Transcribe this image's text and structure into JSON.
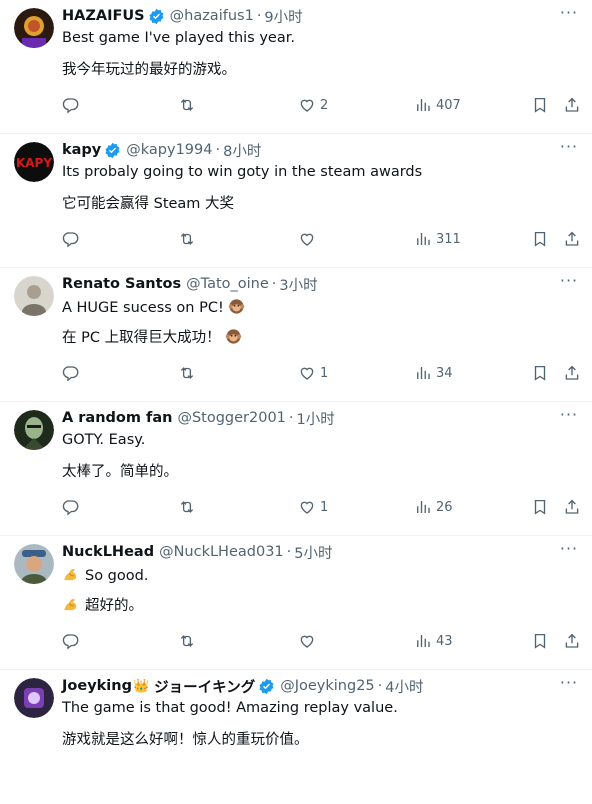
{
  "replies": [
    {
      "name": "HAZAIFUS",
      "handle": "@hazaifus1",
      "time": "9小时",
      "text": "Best game I've played this year.",
      "translation": "我今年玩过的最好的游戏。",
      "replies": "",
      "retweets": "",
      "likes": "2",
      "views": "407",
      "avatar_color": "#3a2a1a"
    },
    {
      "name": "kapy",
      "handle": "@kapy1994",
      "time": "8小时",
      "text": "Its probaly going to win goty in the steam awards",
      "translation": "它可能会赢得 Steam 大奖",
      "replies": "",
      "retweets": "",
      "likes": "",
      "views": "311",
      "avatar_color": "#0d0d0d"
    },
    {
      "name": "Renato Santos",
      "handle": "@Tato_oine",
      "time": "3小时",
      "text": "A HUGE sucess on PC!",
      "translation": "在 PC 上取得巨大成功！",
      "replies": "",
      "retweets": "",
      "likes": "1",
      "views": "34",
      "avatar_color": "#c9c6bd"
    },
    {
      "name": "A random fan",
      "handle": "@Stogger2001",
      "time": "1小时",
      "text": "GOTY. Easy.",
      "translation": "太棒了。简单的。",
      "replies": "",
      "retweets": "",
      "likes": "1",
      "views": "26",
      "avatar_color": "#1f2a1c"
    },
    {
      "name": "NuckLHead",
      "handle": "@NuckLHead031",
      "time": "5小时",
      "text": "So good.",
      "translation": "超好的。",
      "replies": "",
      "retweets": "",
      "likes": "",
      "views": "43",
      "avatar_color": "#7a8a96"
    },
    {
      "name": "Joeyking",
      "name_jp": "ジョーイキング",
      "handle": "@Joeyking25",
      "time": "4小时",
      "text": "The game is that good! Amazing replay value.",
      "translation": "游戏就是这么好啊！惊人的重玩价值。",
      "avatar_color": "#4b2a6b"
    }
  ],
  "common": {
    "dot": "·",
    "more": "···",
    "crown": "👑"
  },
  "colors": {
    "verified": "#1d9bf0",
    "muted": "#536471",
    "divider": "#eff3f4"
  },
  "icons": [
    "reply-icon",
    "retweet-icon",
    "like-icon",
    "views-icon",
    "bookmark-icon",
    "share-icon",
    "verified-badge-icon",
    "more-icon",
    "monkey-emoji-icon",
    "flexed-biceps-emoji-icon",
    "crown-emoji-icon"
  ]
}
